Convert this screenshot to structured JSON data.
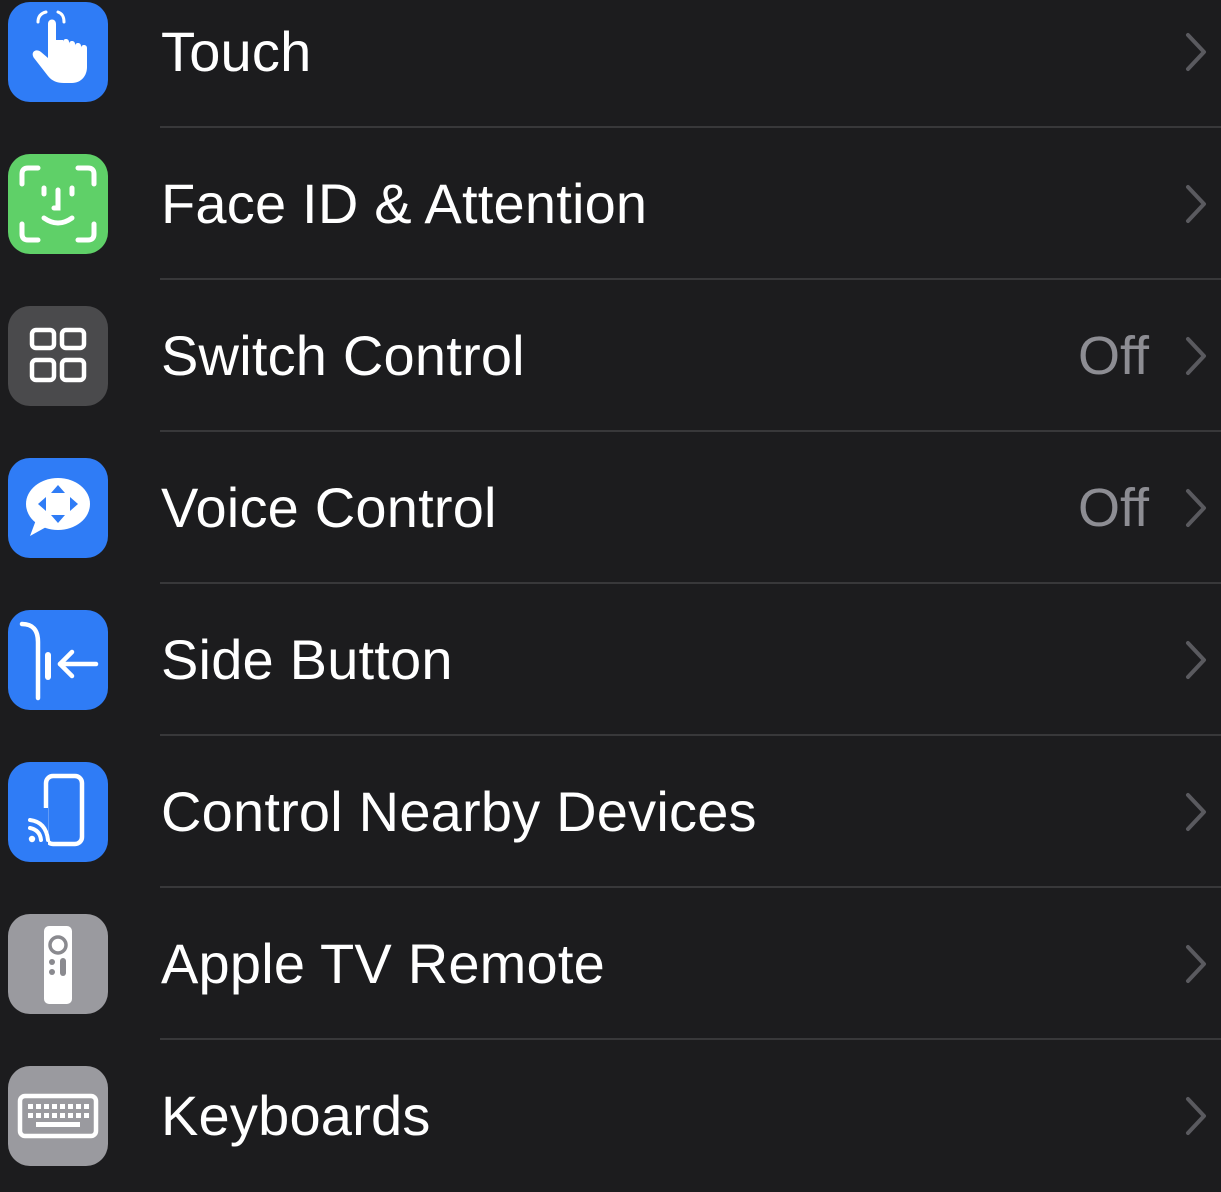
{
  "colors": {
    "background": "#1c1c1e",
    "separator": "#38383a",
    "label": "#ffffff",
    "secondary": "#8d8d93",
    "chevron": "#5a5a5f",
    "blue": "#2f7cf6",
    "green": "#5fd068",
    "gray_dark": "#4a4a4c",
    "gray_light": "#9a9a9f"
  },
  "rows": [
    {
      "label": "Touch",
      "value": "",
      "icon": "hand-pointer-icon",
      "icon_bg": "#2f7cf6"
    },
    {
      "label": "Face ID & Attention",
      "value": "",
      "icon": "face-id-icon",
      "icon_bg": "#5fd068"
    },
    {
      "label": "Switch Control",
      "value": "Off",
      "icon": "grid-squares-icon",
      "icon_bg": "#4a4a4c"
    },
    {
      "label": "Voice Control",
      "value": "Off",
      "icon": "voice-control-icon",
      "icon_bg": "#2f7cf6"
    },
    {
      "label": "Side Button",
      "value": "",
      "icon": "side-button-icon",
      "icon_bg": "#2f7cf6"
    },
    {
      "label": "Control Nearby Devices",
      "value": "",
      "icon": "nearby-devices-icon",
      "icon_bg": "#2f7cf6"
    },
    {
      "label": "Apple TV Remote",
      "value": "",
      "icon": "tv-remote-icon",
      "icon_bg": "#9a9a9f"
    },
    {
      "label": "Keyboards",
      "value": "",
      "icon": "keyboard-icon",
      "icon_bg": "#9a9a9f"
    }
  ]
}
